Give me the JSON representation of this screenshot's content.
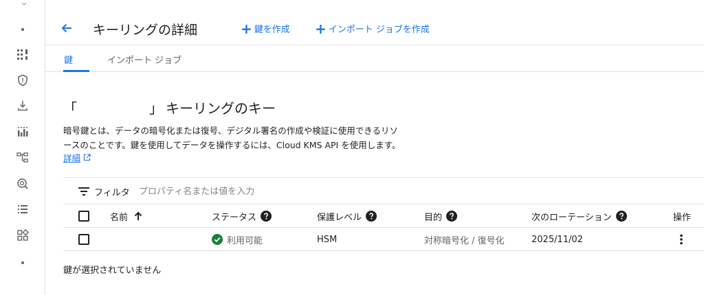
{
  "header": {
    "title": "キーリングの詳細",
    "actions": [
      {
        "label": "鍵を作成",
        "icon": "plus-icon"
      },
      {
        "label": "インポート ジョブを作成",
        "icon": "plus-icon"
      }
    ]
  },
  "tabs": [
    {
      "label": "鍵",
      "active": true
    },
    {
      "label": "インポート ジョブ",
      "active": false
    }
  ],
  "section": {
    "quote_open": "「",
    "quote_close": "」",
    "title_rest": "キーリングのキー",
    "description_line1": "暗号鍵とは、データの暗号化または復号、デジタル署名の作成や検証に使用できるリソ",
    "description_line2": "ースのことです。鍵を使用してデータを操作するには、Cloud KMS API を使用します。",
    "learn_more": "詳細"
  },
  "filter": {
    "label": "フィルタ",
    "placeholder": "プロパティ名または値を入力"
  },
  "table": {
    "columns": {
      "name": "名前",
      "status": "ステータス",
      "protection": "保護レベル",
      "purpose": "目的",
      "next_rotation": "次のローテーション",
      "actions": "操作"
    },
    "rows": [
      {
        "name": "",
        "status": "利用可能",
        "protection": "HSM",
        "purpose": "対称暗号化 / 復号化",
        "next_rotation": "2025/11/02"
      }
    ]
  },
  "selection_status": "鍵が選択されていません",
  "colors": {
    "accent": "#1a73e8",
    "success": "#188038",
    "text": "#202124",
    "muted": "#5f6368",
    "divider": "#e0e0e0"
  },
  "icons": [
    "back-arrow-icon",
    "plus-icon",
    "filter-icon",
    "sort-up-icon",
    "help-icon",
    "check-circle-icon",
    "more-vert-icon",
    "open-in-new-icon"
  ]
}
